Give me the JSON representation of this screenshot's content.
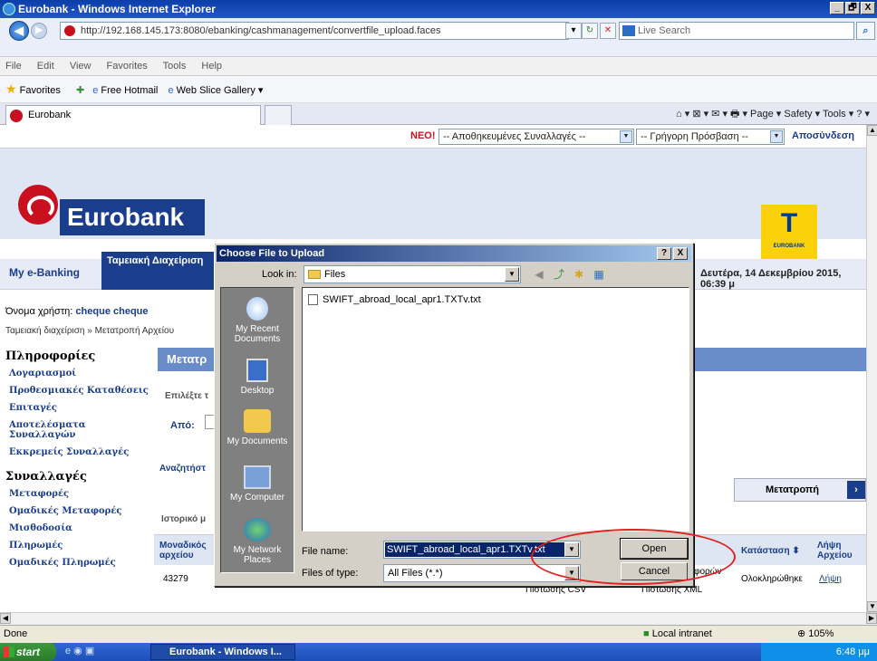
{
  "window": {
    "title": "Eurobank - Windows Internet Explorer",
    "minimize": "_",
    "maximize": "🗗",
    "close": "X"
  },
  "address": {
    "url": "http://192.168.145.173:8080/ebanking/cashmanagement/convertfile_upload.faces"
  },
  "live_search": {
    "placeholder": "Live Search"
  },
  "menu": [
    "File",
    "Edit",
    "View",
    "Favorites",
    "Tools",
    "Help"
  ],
  "favorites_bar": {
    "favorites": "Favorites",
    "hotmail": "Free Hotmail",
    "webslice": "Web Slice Gallery ▾"
  },
  "tab": {
    "label": "Eurobank"
  },
  "command_bar": {
    "text": "⌂ ▾  ⊠ ▾  ✉ ▾  🖶 ▾  Page ▾  Safety ▾  Tools ▾  ? ▾"
  },
  "page": {
    "new_label": "ΝΕΟ!",
    "saved_tx": "-- Αποθηκευμένες Συναλλαγές --",
    "quick_access": "-- Γρήγορη Πρόσβαση --",
    "logout": "Αποσύνδεση",
    "logo_text": "Eurobank",
    "badge_label": "EUROBANK",
    "my_ebanking": "My e-Banking",
    "cash_tab": "Ταμειακή Διαχείριση",
    "date": "Δευτέρα, 14 Δεκεμβρίου 2015, 06:39 μ",
    "user_label": "Όνομα χρήστη:",
    "user_name": "cheque cheque",
    "breadcrumb": "Ταμειακή διαχείριση » Μετατροπή Αρχείου",
    "main_header": "Μετατρ",
    "choose_text": "Επιλέξτε τ",
    "from_label": "Από:",
    "search_label": "Αναζητήστ",
    "convert_btn": "Μετατροπή",
    "history_label": "Ιστορικό μ",
    "sidebar": {
      "info_heading": "Πληροφορίες",
      "info_items": [
        "Λογαριασμοί",
        "Προθεσμιακές Καταθέσεις",
        "Επιταγές",
        "Αποτελέσματα Συναλλαγών",
        "Εκκρεμείς Συναλλαγές"
      ],
      "tx_heading": "Συναλλαγές",
      "tx_items": [
        "Μεταφορές",
        "Ομαδικές Μεταφορές",
        "Μισθοδοσία",
        "Πληρωμές",
        "Ομαδικές Πληρωμές"
      ]
    },
    "table": {
      "headers": [
        "Μοναδικός αρχείου",
        "Κατάσταση ⬍",
        "Λήψη Αρχείου"
      ],
      "row": {
        "id": "43279",
        "col_a": "Πιστωσης CSV",
        "col_b": "Πιστωσης XML",
        "fragment": "φορών",
        "status": "Ολοκληρώθηκε",
        "download": "Λήψη"
      }
    }
  },
  "dialog": {
    "title": "Choose File to Upload",
    "help": "?",
    "close": "X",
    "look_in_label": "Look in:",
    "look_in_value": "Files",
    "places": [
      "My Recent Documents",
      "Desktop",
      "My Documents",
      "My Computer",
      "My Network Places"
    ],
    "files": [
      "SWIFT_abroad_local_apr1.TXTv.txt"
    ],
    "file_name_label": "File name:",
    "file_name_value": "SWIFT_abroad_local_apr1.TXTv.txt",
    "files_of_type_label": "Files of type:",
    "files_of_type_value": "All Files (*.*)",
    "open_btn": "Open",
    "cancel_btn": "Cancel"
  },
  "status": {
    "text": "Done",
    "zone": "Local intranet",
    "zoom": "105%"
  },
  "taskbar": {
    "start": "start",
    "item": "Eurobank - Windows I...",
    "clock": "6:48 μμ"
  }
}
